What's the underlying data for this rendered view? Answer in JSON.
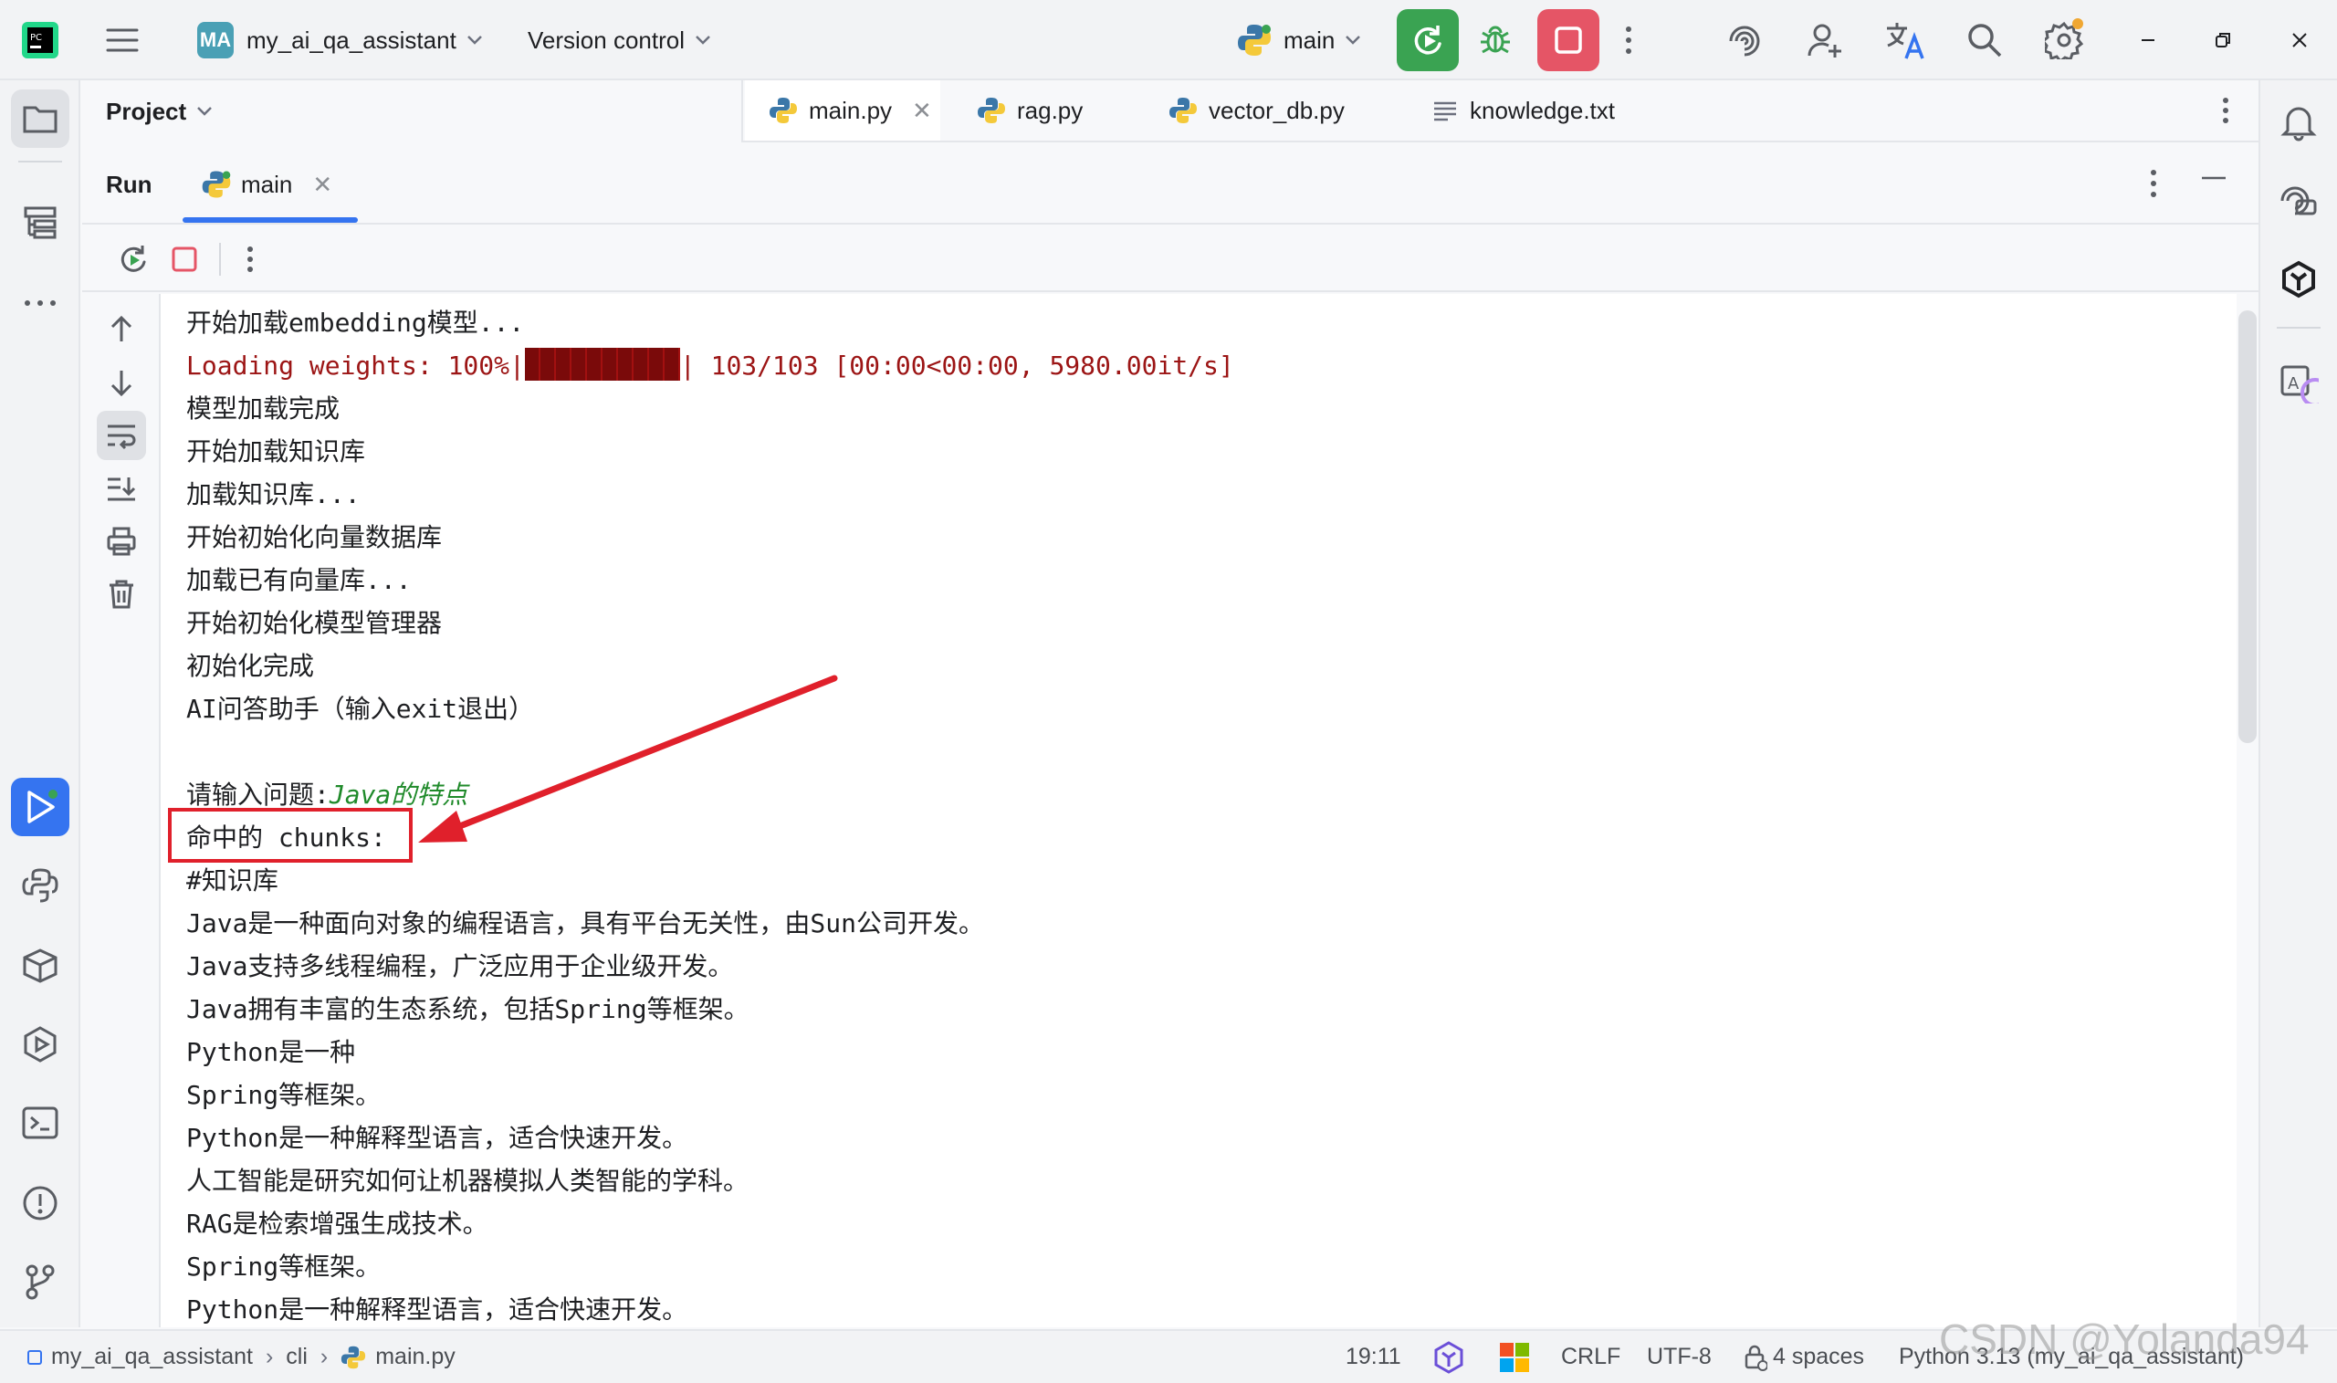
{
  "titlebar": {
    "project_badge": "MA",
    "project_name": "my_ai_qa_assistant",
    "version_control": "Version control",
    "run_config": "main"
  },
  "project_panel": {
    "title": "Project"
  },
  "editor_tabs": [
    {
      "label": "main.py",
      "icon": "python-file-icon",
      "active": true
    },
    {
      "label": "rag.py",
      "icon": "python-file-icon",
      "active": false
    },
    {
      "label": "vector_db.py",
      "icon": "python-file-icon",
      "active": false
    },
    {
      "label": "knowledge.txt",
      "icon": "text-file-icon",
      "active": false
    }
  ],
  "run_window": {
    "title": "Run",
    "tab_label": "main"
  },
  "console": {
    "lines": [
      {
        "text": "开始加载embedding模型..."
      },
      {
        "prefix": "Loading weights: 100%|",
        "suffix": "| 103/103 [00:00<00:00, 5980.00it/s]",
        "style": "stderr",
        "progress": 1.0
      },
      {
        "text": "模型加载完成"
      },
      {
        "text": "开始加载知识库"
      },
      {
        "text": "加载知识库..."
      },
      {
        "text": "开始初始化向量数据库"
      },
      {
        "text": "加载已有向量库..."
      },
      {
        "text": "开始初始化模型管理器"
      },
      {
        "text": "初始化完成"
      },
      {
        "text": "AI问答助手（输入exit退出）"
      },
      {
        "text": ""
      },
      {
        "prompt": "请输入问题:",
        "input": "Java的特点"
      },
      {
        "text": "命中的 chunks:"
      },
      {
        "text": "#知识库"
      },
      {
        "text": "Java是一种面向对象的编程语言，具有平台无关性，由Sun公司开发。"
      },
      {
        "text": "Java支持多线程编程，广泛应用于企业级开发。"
      },
      {
        "text": "Java拥有丰富的生态系统，包括Spring等框架。"
      },
      {
        "text": "Python是一种"
      },
      {
        "text": "Spring等框架。"
      },
      {
        "text": "Python是一种解释型语言，适合快速开发。"
      },
      {
        "text": "人工智能是研究如何让机器模拟人类智能的学科。"
      },
      {
        "text": "RAG是检索增强生成技术。"
      },
      {
        "text": "Spring等框架。"
      },
      {
        "text": "Python是一种解释型语言，适合快速开发。"
      }
    ]
  },
  "statusbar": {
    "breadcrumb": [
      "my_ai_qa_assistant",
      "cli",
      "main.py"
    ],
    "position": "19:11",
    "line_separator": "CRLF",
    "encoding": "UTF-8",
    "indent": "4 spaces",
    "interpreter": "Python 3.13 (my_ai_qa_assistant)"
  },
  "watermark": "CSDN @Yolanda94",
  "colors": {
    "accent": "#3574f0",
    "run_green": "#3aa352",
    "stop_red": "#e55566",
    "stderr_red": "#9c1515",
    "user_input_green": "#1f8a2a",
    "annotation_red": "#e0202b"
  }
}
